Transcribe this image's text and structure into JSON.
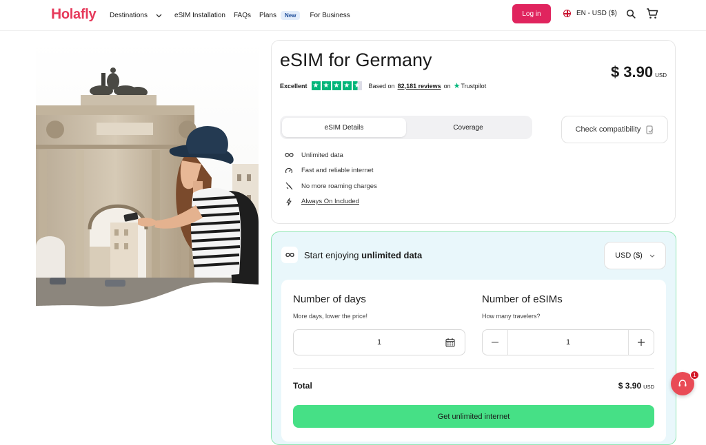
{
  "header": {
    "logo": "Holafly",
    "nav": {
      "destinations": "Destinations",
      "esim_installation": "eSIM Installation",
      "faqs": "FAQs",
      "plans": "Plans",
      "plans_badge": "New",
      "business": "For Business"
    },
    "login": "Log in",
    "language": "EN - USD ($)"
  },
  "product": {
    "title": "eSIM for Germany",
    "rating_word": "Excellent",
    "rating_stars": 4.5,
    "based_on": "Based on",
    "reviews_count": "82,181 reviews",
    "on": "on",
    "trustpilot": "Trustpilot",
    "price": "$ 3.90",
    "price_currency": "USD",
    "tabs": [
      "eSIM Details",
      "Coverage"
    ],
    "check_compatibility": "Check compatibility",
    "features": [
      "Unlimited data",
      "Fast and reliable internet",
      "No more roaming charges",
      "Always On Included"
    ]
  },
  "plan": {
    "title_prefix": "Start enjoying",
    "title_bold": "unlimited data",
    "currency": "USD ($)",
    "days_label": "Number of days",
    "days_sub": "More days, lower the price!",
    "days_value": "1",
    "esims_label": "Number of eSIMs",
    "esims_sub": "How many travelers?",
    "esims_value": "1",
    "total_label": "Total",
    "total_price": "$ 3.90",
    "total_currency": "USD",
    "cta": "Get unlimited internet"
  },
  "chat": {
    "badge": "1"
  },
  "colors": {
    "brand": "#e0245e",
    "trustpilot": "#00b67a",
    "cta": "#46e086",
    "plan_bg": "#e9f7fb"
  }
}
